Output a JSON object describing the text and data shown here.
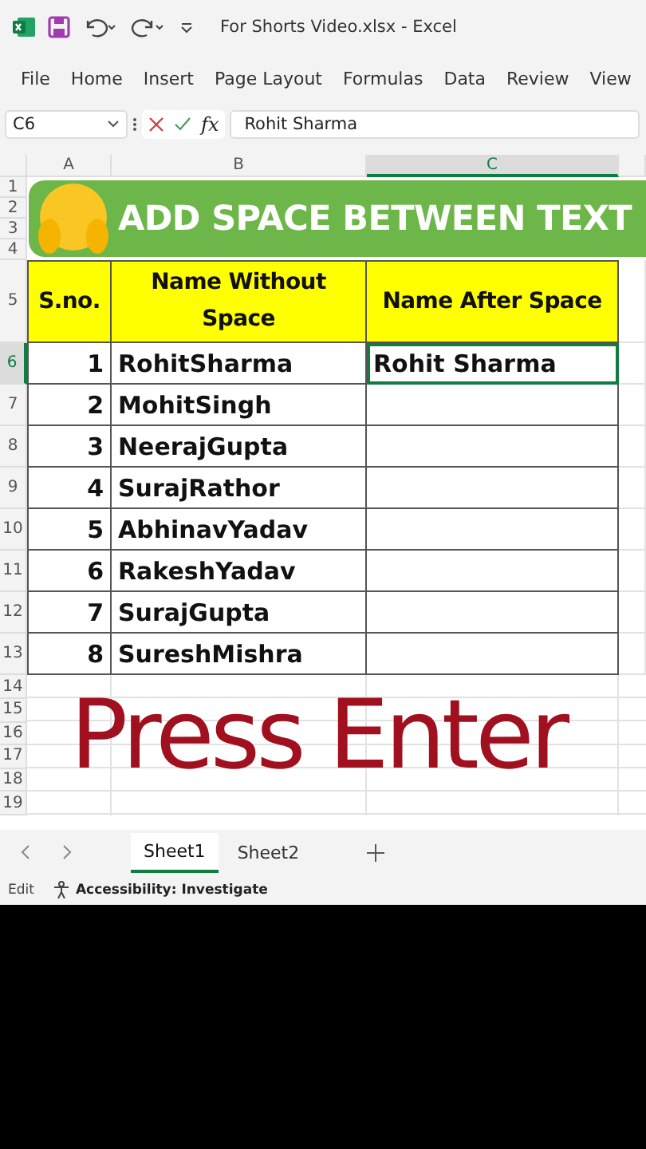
{
  "window": {
    "title": "For Shorts Video.xlsx  -  Excel"
  },
  "ribbon_tabs": [
    "File",
    "Home",
    "Insert",
    "Page Layout",
    "Formulas",
    "Data",
    "Review",
    "View"
  ],
  "formula_bar": {
    "name_box": "C6",
    "function_label": "fx",
    "value": "Rohit Sharma"
  },
  "columns": [
    {
      "label": "A",
      "selected": false
    },
    {
      "label": "B",
      "selected": false
    },
    {
      "label": "C",
      "selected": true
    }
  ],
  "row_numbers": [
    {
      "label": "1",
      "selected": false
    },
    {
      "label": "2",
      "selected": false
    },
    {
      "label": "3",
      "selected": false
    },
    {
      "label": "4",
      "selected": false
    },
    {
      "label": "5",
      "selected": false
    },
    {
      "label": "6",
      "selected": true
    },
    {
      "label": "7",
      "selected": false
    },
    {
      "label": "8",
      "selected": false
    },
    {
      "label": "9",
      "selected": false
    },
    {
      "label": "10",
      "selected": false
    },
    {
      "label": "11",
      "selected": false
    },
    {
      "label": "12",
      "selected": false
    },
    {
      "label": "13",
      "selected": false
    },
    {
      "label": "14",
      "selected": false
    },
    {
      "label": "15",
      "selected": false
    },
    {
      "label": "16",
      "selected": false
    },
    {
      "label": "17",
      "selected": false
    },
    {
      "label": "18",
      "selected": false
    },
    {
      "label": "19",
      "selected": false
    }
  ],
  "banner": {
    "text": "ADD SPACE BETWEEN TEXT"
  },
  "table": {
    "headers": [
      "S.no.",
      "Name Without Space",
      "Name After Space"
    ],
    "rows": [
      {
        "number": "1",
        "name": "RohitSharma",
        "spaced": "Rohit Sharma",
        "selected": true
      },
      {
        "number": "2",
        "name": "MohitSingh",
        "selected": false
      },
      {
        "number": "3",
        "name": "NeerajGupta",
        "selected": false
      },
      {
        "number": "4",
        "name": "SurajRathor",
        "selected": false
      },
      {
        "number": "5",
        "name": "AbhinavYadav",
        "selected": false
      },
      {
        "number": "6",
        "name": "RakeshYadav",
        "selected": false
      },
      {
        "number": "7",
        "name": "SurajGupta",
        "selected": false
      },
      {
        "number": "8",
        "name": "SureshMishra",
        "selected": false
      }
    ]
  },
  "overlay": {
    "text": "Press Enter"
  },
  "sheet_tabs": [
    {
      "label": "Sheet1",
      "selected": true
    },
    {
      "label": "Sheet2",
      "selected": false
    }
  ],
  "status_bar": {
    "mode": "Edit",
    "accessibility": "Accessibility: Investigate"
  }
}
